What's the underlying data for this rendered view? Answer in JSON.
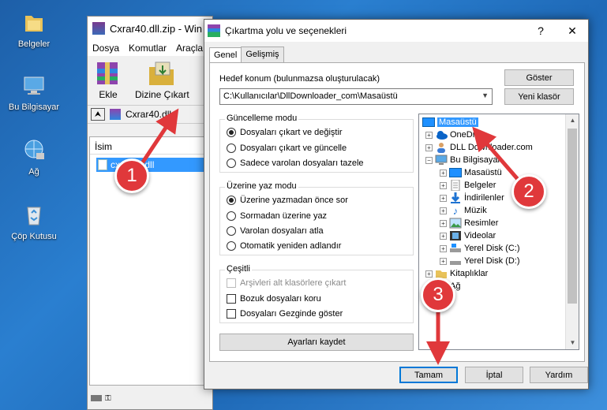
{
  "desktop": {
    "icons": [
      {
        "label": "Belgeler",
        "icon": "folder-documents-icon"
      },
      {
        "label": "Bu Bilgisayar",
        "icon": "computer-icon"
      },
      {
        "label": "Ağ",
        "icon": "network-icon"
      },
      {
        "label": "Çöp Kutusu",
        "icon": "recycle-bin-icon"
      }
    ]
  },
  "winrar": {
    "title": "Cxrar40.dll.zip - Win",
    "menu": [
      "Dosya",
      "Komutlar",
      "Araçla"
    ],
    "toolbar": {
      "add_label": "Ekle",
      "extract_label": "Dizine Çıkart"
    },
    "path_text": "Cxrar40.dll",
    "column_name": "İsim",
    "file_row": "cxrar40.dll"
  },
  "dialog": {
    "title": "Çıkartma yolu ve seçenekleri",
    "help_btn": "?",
    "close_btn": "✕",
    "tabs": [
      "Genel",
      "Gelişmiş"
    ],
    "dest_label": "Hedef konum (bulunmazsa oluşturulacak)",
    "dest_value": "C:\\Kullanıcılar\\DllDownloader_com\\Masaüstü",
    "show_btn": "Göster",
    "new_folder_btn": "Yeni klasör",
    "update_group": {
      "title": "Güncelleme modu",
      "options": [
        "Dosyaları çıkart ve değiştir",
        "Dosyaları çıkart ve güncelle",
        "Sadece varolan dosyaları tazele"
      ],
      "selected": 0
    },
    "overwrite_group": {
      "title": "Üzerine yaz modu",
      "options": [
        "Üzerine yazmadan önce sor",
        "Sormadan üzerine yaz",
        "Varolan dosyaları atla",
        "Otomatik yeniden adlandır"
      ],
      "selected": 0
    },
    "misc_group": {
      "title": "Çeşitli",
      "options": [
        "Arşivleri alt klasörlere çıkart",
        "Bozuk dosyaları koru",
        "Dosyaları Gezginde göster"
      ]
    },
    "save_settings_btn": "Ayarları kaydet",
    "tree": [
      {
        "label": "Masaüstü",
        "icon": "desktop-icon",
        "level": 0,
        "expander": "",
        "selected": true
      },
      {
        "label": "OneDrive",
        "icon": "onedrive-icon",
        "level": 1,
        "expander": "+"
      },
      {
        "label": "DLL Downloader.com",
        "icon": "user-icon",
        "level": 1,
        "expander": "+"
      },
      {
        "label": "Bu Bilgisayar",
        "icon": "computer-icon",
        "level": 1,
        "expander": "−"
      },
      {
        "label": "Masaüstü",
        "icon": "desktop-icon",
        "level": 2,
        "expander": "+"
      },
      {
        "label": "Belgeler",
        "icon": "documents-icon",
        "level": 2,
        "expander": "+"
      },
      {
        "label": "İndirilenler",
        "icon": "downloads-icon",
        "level": 2,
        "expander": "+"
      },
      {
        "label": "Müzik",
        "icon": "music-icon",
        "level": 2,
        "expander": "+"
      },
      {
        "label": "Resimler",
        "icon": "pictures-icon",
        "level": 2,
        "expander": "+"
      },
      {
        "label": "Videolar",
        "icon": "videos-icon",
        "level": 2,
        "expander": "+"
      },
      {
        "label": "Yerel Disk (C:)",
        "icon": "drive-icon",
        "level": 2,
        "expander": "+"
      },
      {
        "label": "Yerel Disk (D:)",
        "icon": "drive-icon",
        "level": 2,
        "expander": "+"
      },
      {
        "label": "Kitaplıklar",
        "icon": "libraries-icon",
        "level": 1,
        "expander": "+"
      },
      {
        "label": "Ağ",
        "icon": "network-icon",
        "level": 1,
        "expander": "+"
      }
    ],
    "ok_btn": "Tamam",
    "cancel_btn": "İptal",
    "help_button": "Yardım"
  },
  "annotations": {
    "steps": [
      "1",
      "2",
      "3"
    ],
    "color": "#e0383b"
  }
}
